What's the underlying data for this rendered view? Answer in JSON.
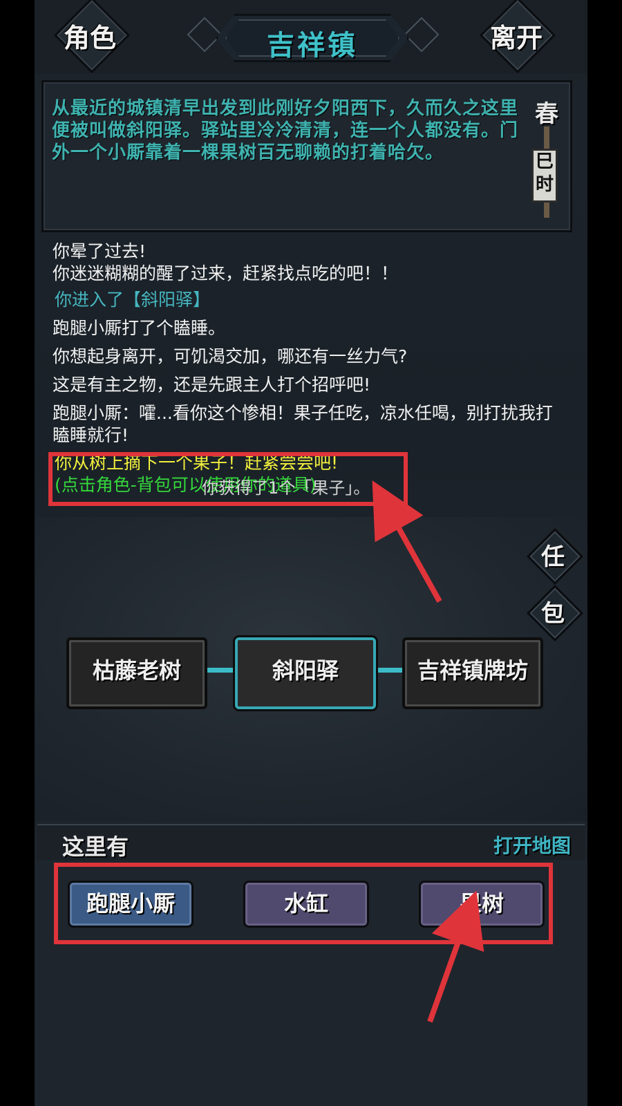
{
  "header": {
    "left_button": "角色",
    "title": "吉祥镇",
    "right_button": "离开"
  },
  "description": {
    "text": "从最近的城镇清早出发到此刚好夕阳西下，久而久之这里便被叫做斜阳驿。驿站里冷冷清清，连一个人都没有。门外一个小厮靠着一棵果树百无聊赖的打着哈欠。",
    "season": "春",
    "time": "巳时"
  },
  "log": {
    "lines": [
      "你晕了过去!",
      "你迷迷糊糊的醒了过来，赶紧找点吃的吧！！",
      "你进入了【斜阳驿】",
      "跑腿小厮打了个瞌睡。",
      "你想起身离开，可饥渴交加，哪还有一丝力气?",
      "这是有主之物，还是先跟主人打个招呼吧!",
      "跑腿小厮：嚯...看你这个惨相！果子任吃，凉水任喝，别打扰我打瞌睡就行!",
      "你从树上摘下一个果子！赶紧尝尝吧!",
      "(点击角色-背包可以使用你的道具)"
    ],
    "overlay_toast": "你获得了1个「果子」。"
  },
  "side_buttons": {
    "task": "任",
    "bag": "包"
  },
  "map_nodes": [
    {
      "label": "枯藤老树"
    },
    {
      "label": "斜阳驿"
    },
    {
      "label": "吉祥镇牌坊"
    }
  ],
  "here": {
    "title": "这里有",
    "open_map": "打开地图",
    "items": [
      {
        "label": "跑腿小厮"
      },
      {
        "label": "水缸"
      },
      {
        "label": "果树"
      }
    ]
  },
  "colors": {
    "accent_teal": "#3fc1c9",
    "log_yellow": "#f3f03d",
    "log_green": "#35d83b",
    "annotation_red": "#e0343b"
  }
}
